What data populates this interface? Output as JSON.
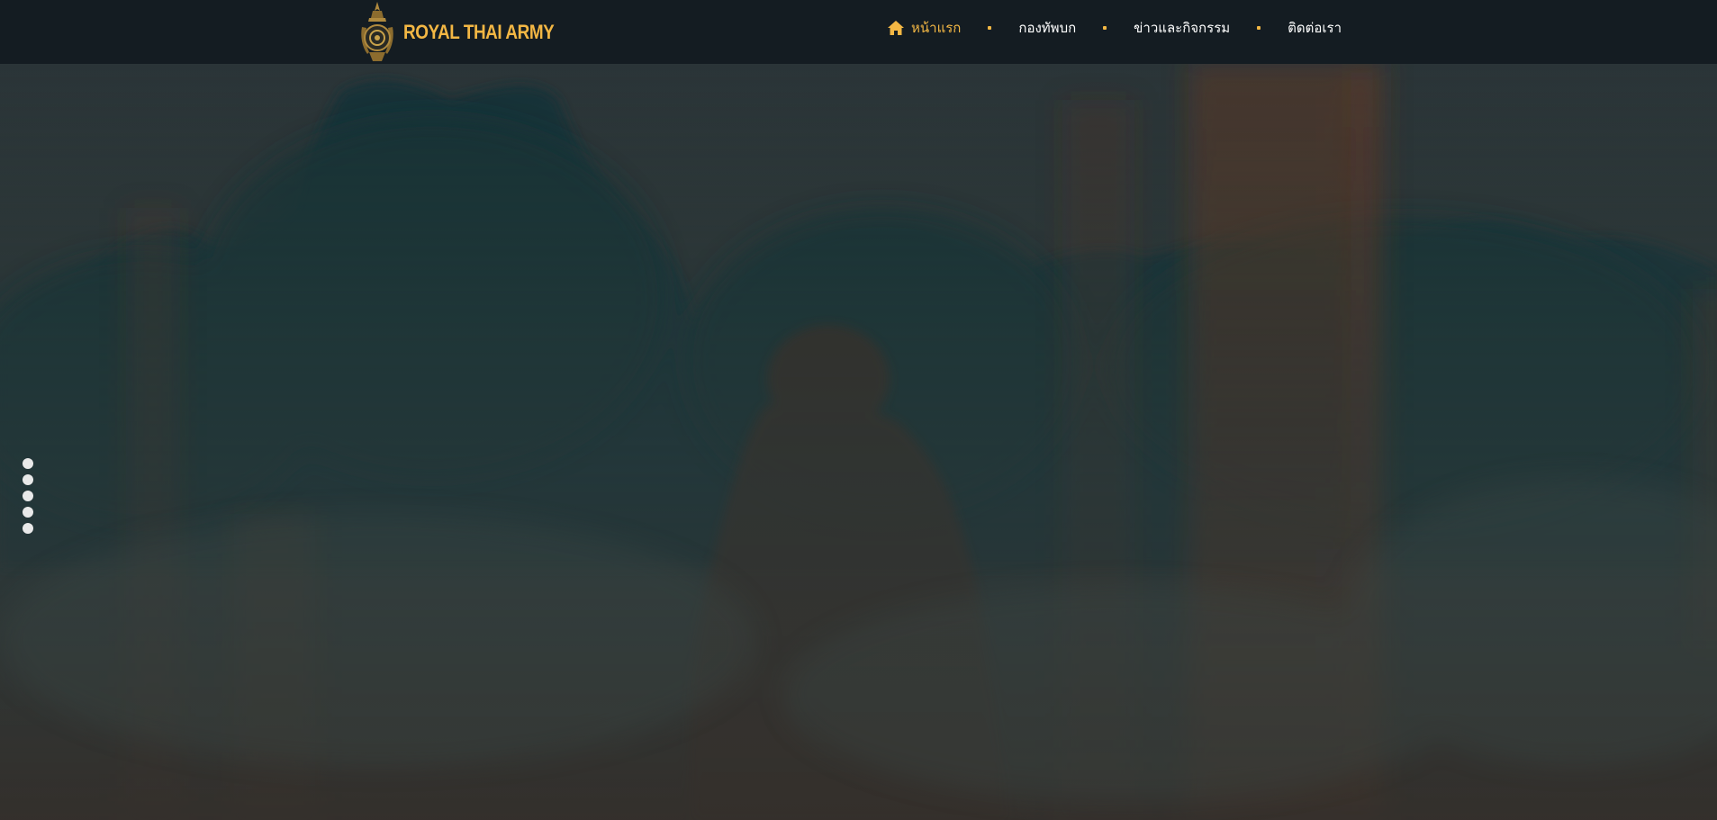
{
  "header": {
    "logo_text": "ROYAL THAI ARMY",
    "logo_icon": "army-emblem-icon"
  },
  "nav": {
    "items": [
      {
        "label": "หน้าแรก",
        "icon": "home-icon",
        "active": true
      },
      {
        "label": "กองทัพบก",
        "active": false
      },
      {
        "label": "ข่าวและกิจกรรม",
        "active": false
      },
      {
        "label": "ติดต่อเรา",
        "active": false
      }
    ]
  },
  "slider": {
    "slide_count": 5
  },
  "colors": {
    "header_bg": "#141c22",
    "accent": "#f3b744",
    "nav_text": "#ffffff",
    "dot": "#e9e9e9"
  }
}
